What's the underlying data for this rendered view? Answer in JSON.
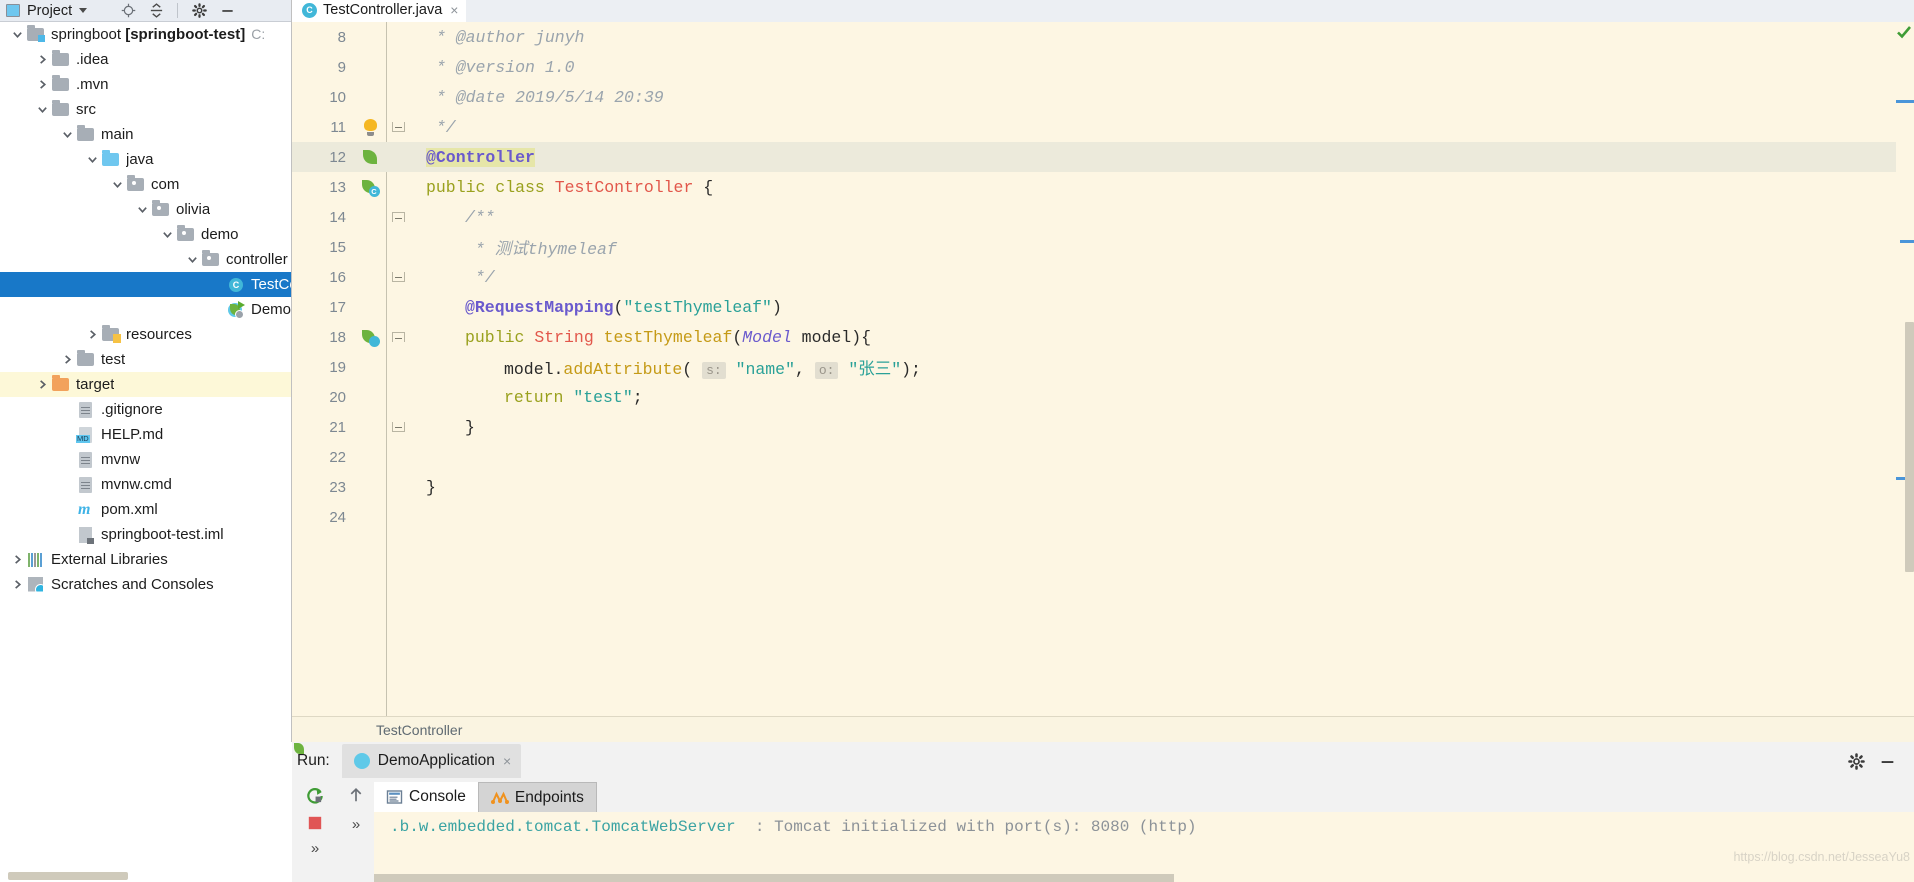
{
  "project_panel": {
    "title": "Project",
    "icons": [
      "project-window-icon",
      "chevron-down-icon",
      "locate-icon",
      "collapse-all-icon",
      "gear-icon",
      "minimize-icon"
    ],
    "tree": [
      {
        "indent": 0,
        "arrow": "down",
        "icon": "module-folder-icon",
        "label": "springboot ",
        "bold": "[springboot-test]",
        "path": "C:",
        "state": "normal"
      },
      {
        "indent": 1,
        "arrow": "right",
        "icon": "folder-icon",
        "label": ".idea",
        "state": "normal"
      },
      {
        "indent": 1,
        "arrow": "right",
        "icon": "folder-icon",
        "label": ".mvn",
        "state": "normal"
      },
      {
        "indent": 1,
        "arrow": "down",
        "icon": "folder-icon",
        "label": "src",
        "state": "normal"
      },
      {
        "indent": 2,
        "arrow": "down",
        "icon": "folder-icon",
        "label": "main",
        "state": "normal"
      },
      {
        "indent": 3,
        "arrow": "down",
        "icon": "source-folder-icon",
        "label": "java",
        "state": "normal"
      },
      {
        "indent": 4,
        "arrow": "down",
        "icon": "package-icon",
        "label": "com",
        "state": "normal"
      },
      {
        "indent": 5,
        "arrow": "down",
        "icon": "package-icon",
        "label": "olivia",
        "state": "normal"
      },
      {
        "indent": 6,
        "arrow": "down",
        "icon": "package-icon",
        "label": "demo",
        "state": "normal"
      },
      {
        "indent": 7,
        "arrow": "down",
        "icon": "package-icon",
        "label": "controller",
        "state": "normal"
      },
      {
        "indent": 8,
        "arrow": "none",
        "icon": "java-class-icon",
        "label": "TestController",
        "state": "selected"
      },
      {
        "indent": 8,
        "arrow": "none",
        "icon": "spring-boot-app-icon",
        "label": "DemoApplication",
        "state": "normal"
      },
      {
        "indent": 3,
        "arrow": "right",
        "icon": "resources-folder-icon",
        "label": "resources",
        "state": "normal"
      },
      {
        "indent": 2,
        "arrow": "right",
        "icon": "folder-icon",
        "label": "test",
        "state": "normal"
      },
      {
        "indent": 1,
        "arrow": "right",
        "icon": "excluded-folder-icon",
        "label": "target",
        "state": "hovered"
      },
      {
        "indent": 2,
        "arrow": "none",
        "icon": "text-file-icon",
        "label": ".gitignore",
        "state": "normal"
      },
      {
        "indent": 2,
        "arrow": "none",
        "icon": "markdown-file-icon",
        "label": "HELP.md",
        "state": "normal"
      },
      {
        "indent": 2,
        "arrow": "none",
        "icon": "text-file-icon",
        "label": "mvnw",
        "state": "normal"
      },
      {
        "indent": 2,
        "arrow": "none",
        "icon": "text-file-icon",
        "label": "mvnw.cmd",
        "state": "normal"
      },
      {
        "indent": 2,
        "arrow": "none",
        "icon": "maven-file-icon",
        "label": "pom.xml",
        "state": "normal"
      },
      {
        "indent": 2,
        "arrow": "none",
        "icon": "iml-file-icon",
        "label": "springboot-test.iml",
        "state": "normal"
      },
      {
        "indent": 0,
        "arrow": "right",
        "icon": "libraries-icon",
        "label": "External Libraries",
        "state": "normal"
      },
      {
        "indent": 0,
        "arrow": "right",
        "icon": "scratches-icon",
        "label": "Scratches and Consoles",
        "state": "normal"
      }
    ]
  },
  "editor": {
    "tab": {
      "label": "TestController.java",
      "icon": "java-class-icon",
      "close": "×"
    },
    "breadcrumb": "TestController",
    "inspection_status": "ok-check-icon",
    "lines": [
      {
        "num": "8",
        "gutter": "",
        "fold": "",
        "indent": 0,
        "tokens": [
          {
            "t": "comment",
            "v": " * @author junyh"
          }
        ]
      },
      {
        "num": "9",
        "gutter": "",
        "fold": "",
        "indent": 0,
        "tokens": [
          {
            "t": "comment",
            "v": " * @version 1.0"
          }
        ]
      },
      {
        "num": "10",
        "gutter": "",
        "fold": "",
        "indent": 0,
        "tokens": [
          {
            "t": "comment",
            "v": " * @date 2019/5/14 20:39"
          }
        ]
      },
      {
        "num": "11",
        "gutter": "bulb",
        "fold": "bot",
        "indent": 0,
        "tokens": [
          {
            "t": "comment",
            "v": " */"
          }
        ]
      },
      {
        "num": "12",
        "gutter": "spring-leaf",
        "fold": "",
        "indent": 0,
        "cursor": true,
        "tokens": [
          {
            "t": "annotation-hl",
            "v": "@Controller"
          }
        ]
      },
      {
        "num": "13",
        "gutter": "bean",
        "fold": "",
        "indent": 0,
        "tokens": [
          {
            "t": "kw",
            "v": "public class "
          },
          {
            "t": "cls",
            "v": "TestController"
          },
          {
            "t": "plain",
            "v": " {"
          }
        ]
      },
      {
        "num": "14",
        "gutter": "",
        "fold": "top",
        "indent": 1,
        "tokens": [
          {
            "t": "comment",
            "v": "/**"
          }
        ]
      },
      {
        "num": "15",
        "gutter": "",
        "fold": "line",
        "indent": 1,
        "tokens": [
          {
            "t": "comment",
            "v": " * 测试thymeleaf"
          }
        ]
      },
      {
        "num": "16",
        "gutter": "",
        "fold": "bot",
        "indent": 1,
        "tokens": [
          {
            "t": "comment",
            "v": " */"
          }
        ]
      },
      {
        "num": "17",
        "gutter": "",
        "fold": "",
        "indent": 1,
        "tokens": [
          {
            "t": "annotation",
            "v": "@RequestMapping"
          },
          {
            "t": "plain",
            "v": "("
          },
          {
            "t": "str",
            "v": "\"testThymeleaf\""
          },
          {
            "t": "plain",
            "v": ")"
          }
        ]
      },
      {
        "num": "18",
        "gutter": "bean2",
        "fold": "top",
        "indent": 1,
        "tokens": [
          {
            "t": "kw",
            "v": "public "
          },
          {
            "t": "cls",
            "v": "String "
          },
          {
            "t": "mth",
            "v": "testThymeleaf"
          },
          {
            "t": "plain",
            "v": "("
          },
          {
            "t": "param",
            "v": "Model"
          },
          {
            "t": "plain",
            "v": " model){"
          }
        ]
      },
      {
        "num": "19",
        "gutter": "",
        "fold": "line",
        "indent": 2,
        "tokens": [
          {
            "t": "plain",
            "v": "model."
          },
          {
            "t": "mth",
            "v": "addAttribute"
          },
          {
            "t": "plain",
            "v": "( "
          },
          {
            "t": "hint",
            "v": "s:"
          },
          {
            "t": "plain",
            "v": " "
          },
          {
            "t": "str",
            "v": "\"name\""
          },
          {
            "t": "plain",
            "v": ", "
          },
          {
            "t": "hint",
            "v": "o:"
          },
          {
            "t": "plain",
            "v": " "
          },
          {
            "t": "str",
            "v": "\"张三\""
          },
          {
            "t": "plain",
            "v": ");"
          }
        ]
      },
      {
        "num": "20",
        "gutter": "",
        "fold": "line",
        "indent": 2,
        "tokens": [
          {
            "t": "kw",
            "v": "return "
          },
          {
            "t": "str",
            "v": "\"test\""
          },
          {
            "t": "plain",
            "v": ";"
          }
        ]
      },
      {
        "num": "21",
        "gutter": "",
        "fold": "bot",
        "indent": 1,
        "tokens": [
          {
            "t": "plain",
            "v": "}"
          }
        ]
      },
      {
        "num": "22",
        "gutter": "",
        "fold": "",
        "indent": 0,
        "tokens": []
      },
      {
        "num": "23",
        "gutter": "",
        "fold": "",
        "indent": 0,
        "tokens": [
          {
            "t": "plain",
            "v": "}"
          }
        ]
      },
      {
        "num": "24",
        "gutter": "",
        "fold": "",
        "indent": 0,
        "tokens": []
      }
    ]
  },
  "run_panel": {
    "run_label": "Run:",
    "run_tab": {
      "label": "DemoApplication",
      "icon": "spring-boot-app-icon",
      "close": "×"
    },
    "header_actions": [
      "gear-icon",
      "minimize-icon"
    ],
    "side_actions": [
      "rerun-icon",
      "stop-icon",
      "expand-icon"
    ],
    "nav_actions": [
      "scroll-up-icon",
      "expand-more-icon"
    ],
    "console_tabs": [
      {
        "label": "Console",
        "icon": "console-icon",
        "active": true
      },
      {
        "label": "Endpoints",
        "icon": "endpoints-icon",
        "active": false
      }
    ],
    "console_lines": [
      {
        "logger": ".b.w.embedded.tomcat.TomcatWebServer",
        "sep": "  : ",
        "message": "Tomcat initialized with port(s): 8080 (http)"
      }
    ]
  },
  "watermark": "https://blog.csdn.net/JesseaYu8",
  "colors": {
    "selection_blue": "#1878c8",
    "editor_bg": "#fdf6e3",
    "cursor_line": "#eceadb",
    "string_teal": "#2aa198",
    "annotation_purple": "#6a5acd",
    "class_red": "#e2574b",
    "keyword_olive": "#9aa11e",
    "method_gold": "#c59a16",
    "spring_green": "#6db33f"
  }
}
